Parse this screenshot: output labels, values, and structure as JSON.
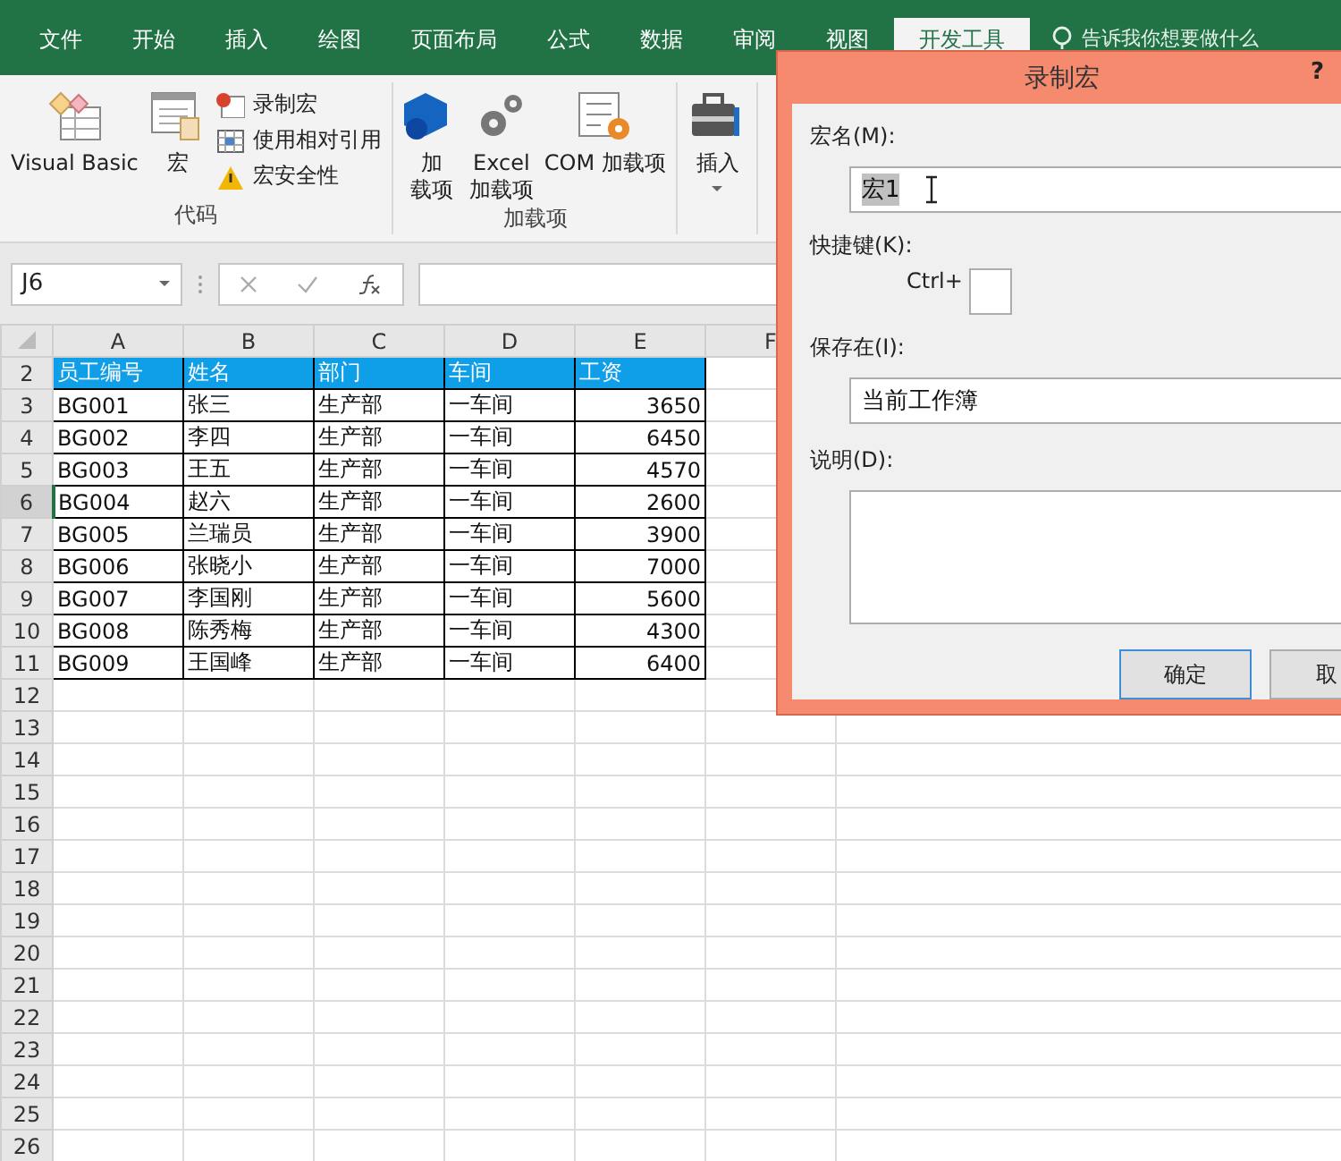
{
  "tabs": [
    {
      "label": "文件",
      "selected": false
    },
    {
      "label": "开始",
      "selected": false
    },
    {
      "label": "插入",
      "selected": false
    },
    {
      "label": "绘图",
      "selected": false
    },
    {
      "label": "页面布局",
      "selected": false
    },
    {
      "label": "公式",
      "selected": false
    },
    {
      "label": "数据",
      "selected": false
    },
    {
      "label": "审阅",
      "selected": false
    },
    {
      "label": "视图",
      "selected": false
    },
    {
      "label": "开发工具",
      "selected": true
    }
  ],
  "search": {
    "placeholder": "告诉我你想要做什么"
  },
  "ribbon": {
    "groups": [
      {
        "label": "代码",
        "items": [
          {
            "kind": "large",
            "lines": [
              "Visual Basic"
            ]
          },
          {
            "kind": "large",
            "lines": [
              "宏"
            ]
          },
          {
            "kind": "stack",
            "entries": [
              "录制宏",
              "使用相对引用",
              "宏安全性"
            ]
          }
        ]
      },
      {
        "label": "加载项",
        "items": [
          {
            "kind": "large",
            "lines": [
              "加",
              "载项"
            ]
          },
          {
            "kind": "large",
            "lines": [
              "Excel",
              "加载项"
            ]
          },
          {
            "kind": "large",
            "lines": [
              "COM 加载项"
            ]
          }
        ]
      },
      {
        "items": [
          {
            "kind": "dropdown",
            "lines": [
              "插入"
            ]
          }
        ]
      }
    ]
  },
  "formula_bar": {
    "name_box": "J6"
  },
  "sheet": {
    "columns": [
      "A",
      "B",
      "C",
      "D",
      "E",
      "F"
    ],
    "rows": [
      {
        "number": "2",
        "kind": "header",
        "selected": false,
        "cells": [
          "员工编号",
          "姓名",
          "部门",
          "车间",
          "工资"
        ]
      },
      {
        "number": "3",
        "kind": "data",
        "selected": false,
        "cells": [
          "BG001",
          "张三",
          "生产部",
          "一车间",
          "3650"
        ]
      },
      {
        "number": "4",
        "kind": "data",
        "selected": false,
        "cells": [
          "BG002",
          "李四",
          "生产部",
          "一车间",
          "6450"
        ]
      },
      {
        "number": "5",
        "kind": "data",
        "selected": false,
        "cells": [
          "BG003",
          "王五",
          "生产部",
          "一车间",
          "4570"
        ]
      },
      {
        "number": "6",
        "kind": "data",
        "selected": true,
        "cells": [
          "BG004",
          "赵六",
          "生产部",
          "一车间",
          "2600"
        ]
      },
      {
        "number": "7",
        "kind": "data",
        "selected": false,
        "cells": [
          "BG005",
          "兰瑞员",
          "生产部",
          "一车间",
          "3900"
        ]
      },
      {
        "number": "8",
        "kind": "data",
        "selected": false,
        "cells": [
          "BG006",
          "张晓小",
          "生产部",
          "一车间",
          "7000"
        ]
      },
      {
        "number": "9",
        "kind": "data",
        "selected": false,
        "cells": [
          "BG007",
          "李国刚",
          "生产部",
          "一车间",
          "5600"
        ]
      },
      {
        "number": "10",
        "kind": "data",
        "selected": false,
        "cells": [
          "BG008",
          "陈秀梅",
          "生产部",
          "一车间",
          "4300"
        ]
      },
      {
        "number": "11",
        "kind": "data",
        "selected": false,
        "cells": [
          "BG009",
          "王国峰",
          "生产部",
          "一车间",
          "6400"
        ]
      },
      {
        "number": "12",
        "kind": "empty",
        "selected": false
      },
      {
        "number": "13",
        "kind": "empty",
        "selected": false
      },
      {
        "number": "14",
        "kind": "empty",
        "selected": false
      },
      {
        "number": "15",
        "kind": "empty",
        "selected": false
      },
      {
        "number": "16",
        "kind": "empty",
        "selected": false
      },
      {
        "number": "17",
        "kind": "empty",
        "selected": false
      },
      {
        "number": "18",
        "kind": "empty",
        "selected": false
      },
      {
        "number": "19",
        "kind": "empty",
        "selected": false
      },
      {
        "number": "20",
        "kind": "empty",
        "selected": false
      },
      {
        "number": "21",
        "kind": "empty",
        "selected": false
      },
      {
        "number": "22",
        "kind": "empty",
        "selected": false
      },
      {
        "number": "23",
        "kind": "empty",
        "selected": false
      },
      {
        "number": "24",
        "kind": "empty",
        "selected": false
      },
      {
        "number": "25",
        "kind": "empty",
        "selected": false
      },
      {
        "number": "26",
        "kind": "empty",
        "selected": false
      }
    ]
  },
  "dialog": {
    "title": "录制宏",
    "help": "?",
    "macro_name": {
      "label": "宏名(M):",
      "value": "宏1",
      "selected": true
    },
    "shortcut": {
      "label": "快捷键(K):",
      "prefix": "Ctrl+"
    },
    "store_in": {
      "label": "保存在(I):",
      "value": "当前工作簿"
    },
    "description": {
      "label": "说明(D):"
    },
    "buttons": [
      {
        "label": "确定",
        "default": true
      },
      {
        "label": "取",
        "default": false
      }
    ]
  }
}
